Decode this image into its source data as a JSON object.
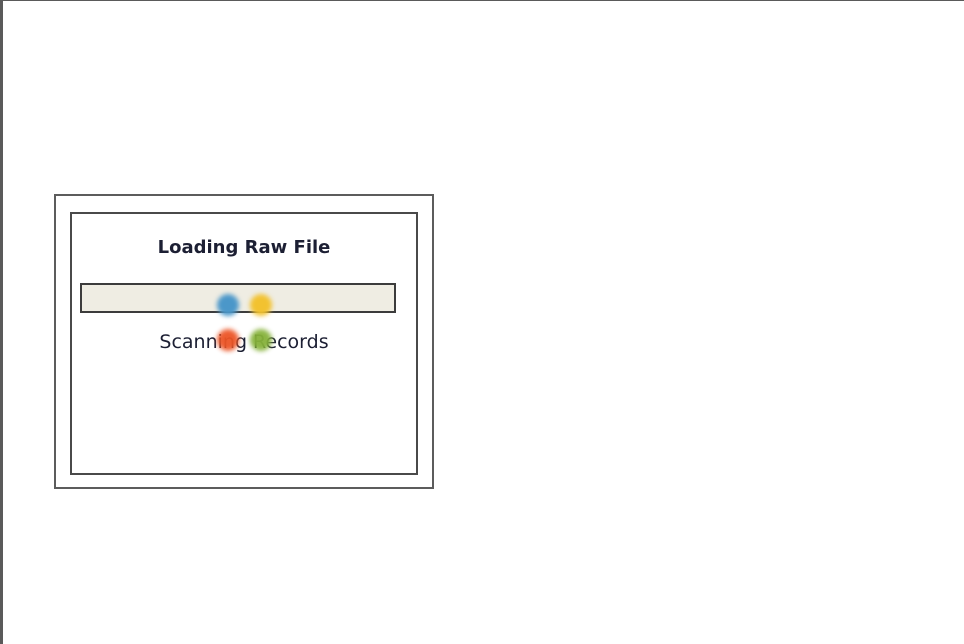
{
  "dialog": {
    "title": "Loading Raw File",
    "status": "Scanning Records",
    "progress": null
  },
  "spinner": {
    "icon": "loading-spinner-icon",
    "dots": [
      {
        "name": "spinner-dot-blue-icon",
        "color": "#4b97c9"
      },
      {
        "name": "spinner-dot-yellow-icon",
        "color": "#f2c230"
      },
      {
        "name": "spinner-dot-red-icon",
        "color": "#ec5526"
      },
      {
        "name": "spinner-dot-green-icon",
        "color": "#86b23a"
      }
    ]
  },
  "colors": {
    "progress_track": "#efede3",
    "text": "#1c1f33",
    "border": "#4a4a4a"
  }
}
